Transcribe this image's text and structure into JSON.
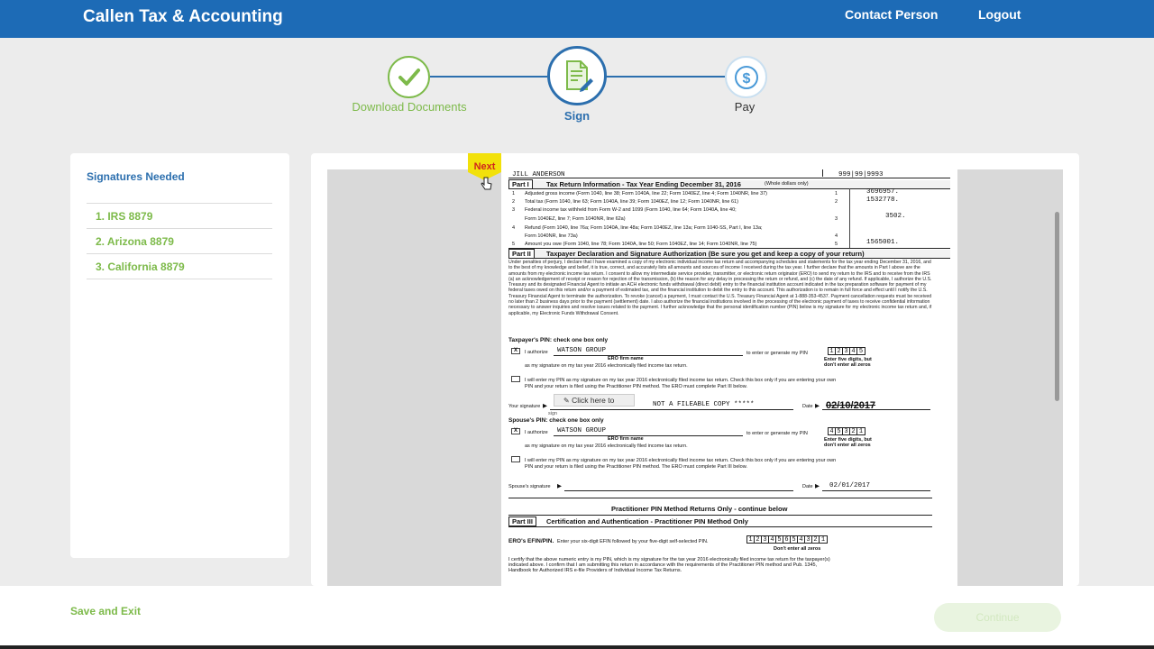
{
  "header": {
    "brand": "Callen Tax & Accounting",
    "contact_label": "Contact Person",
    "logout_label": "Logout"
  },
  "stepper": {
    "steps": [
      {
        "label": "Download Documents",
        "status": "complete",
        "icon": "checkmark-icon"
      },
      {
        "label": "Sign",
        "status": "current",
        "icon": "document-pen-icon"
      },
      {
        "label": "Pay",
        "status": "upcoming",
        "icon": "dollar-icon"
      }
    ]
  },
  "sidebar": {
    "title": "Signatures Needed",
    "items": [
      {
        "label": "1. IRS 8879"
      },
      {
        "label": "2. Arizona 8879"
      },
      {
        "label": "3. California 8879"
      }
    ]
  },
  "next_tag": "Next",
  "document": {
    "taxpayer_name": "JILL  ANDERSON",
    "ssn": "999|99|9993",
    "part1_tag": "Part I",
    "part1_title": "Tax Return Information - Tax Year Ending December 31, 2016",
    "part1_note": "(Whole dollars only)",
    "lines": [
      {
        "num": "1",
        "text": "Adjusted gross income (Form 1040, line 38; Form 1040A, line 22; Form 1040EZ, line 4; Form 1040NR, line 37)",
        "box": "1",
        "amount": "3696957."
      },
      {
        "num": "2",
        "text": "Total tax (Form 1040, line 63; Form 1040A, line 39; Form 1040EZ, line 12; Form 1040NR, line 61)",
        "box": "2",
        "amount": "1532778."
      },
      {
        "num": "3",
        "text": "Federal income tax withheld from Form W-2 and 1099 (Form 1040, line 64; Form 1040A, line 40;",
        "text2": "Form 1040EZ, line 7; Form 1040NR, line 62a)",
        "box": "3",
        "amount": "3502."
      },
      {
        "num": "4",
        "text": "Refund (Form 1040, line 76a; Form 1040A, line 48a; Form 1040EZ, line 13a; Form 1040-SS, Part I, line 13a;",
        "text2": "Form 1040NR, line 73a)",
        "box": "4",
        "amount": ""
      },
      {
        "num": "5",
        "text": "Amount you owe (Form 1040, line 78; Form 1040A, line 50; Form 1040EZ, line 14; Form 1040NR, line 75)",
        "box": "5",
        "amount": "1565001."
      }
    ],
    "part2_tag": "Part II",
    "part2_title": "Taxpayer Declaration and Signature Authorization (Be sure you get and keep a copy of your return)",
    "declaration": "Under penalties of perjury, I declare that I have examined a copy of my electronic individual income tax return and accompanying schedules and statements for the tax year ending December 31, 2016, and to the best of my knowledge and belief, it is true, correct, and accurately lists all amounts and sources of income I received during the tax year. I further declare that the amounts in Part I above are the amounts from my electronic income tax return. I consent to allow my intermediate service provider, transmitter, or electronic return originator (ERO) to send my return to the IRS and to receive from the IRS (a) an acknowledgement of receipt or reason for rejection of the transmission, (b) the reason for any delay in processing the return or refund, and (c) the date of any refund. If applicable, I authorize the U.S. Treasury and its designated Financial Agent to initiate an ACH electronic funds withdrawal (direct debit) entry to the financial institution account indicated in the tax preparation software for payment of my federal taxes owed on this return and/or a payment of estimated tax, and the financial institution to debit the entry to this account. This authorization is to remain in full force and effect until I notify the U.S. Treasury Financial Agent to terminate the authorization. To revoke (cancel) a payment, I must contact the U.S. Treasury Financial Agent at 1-888-353-4537. Payment cancellation requests must be received no later than 2 business days prior to the payment (settlement) date. I also authorize the financial institutions involved in the processing of the electronic payment of taxes to receive confidential information necessary to answer inquiries and resolve issues related to the payment. I further acknowledge that the personal identification number (PIN) below is my signature for my electronic income tax return and, if applicable, my Electronic Funds Withdrawal Consent.",
    "taxpayer_pin_heading": "Taxpayer's PIN: check one box only",
    "i_authorize": "I authorize",
    "firm_name": "WATSON GROUP",
    "ero_firm_label": "ERO firm name",
    "to_enter_pin": "to enter or generate my PIN",
    "taxpayer_pin": [
      "1",
      "2",
      "3",
      "4",
      "5"
    ],
    "pin_note_1": "Enter five digits, but",
    "pin_note_2": "don't enter all zeros",
    "as_signature": "as my signature on my tax year 2016 electronically filed income tax return.",
    "self_enter_1": "I will enter my PIN as my signature on my tax year 2016 electronically filed income tax return. Check this box only if you are entering your own",
    "self_enter_2": "PIN and your return is filed using the Practitioner PIN method. The ERO must complete Part III below.",
    "your_signature_label": "Your signature",
    "not_fileable": "NOT A FILEABLE COPY *****",
    "date_label": "Date",
    "taxpayer_date": "02/10/2017",
    "click_here": "Click here to",
    "sign_word": "sign",
    "spouse_pin_heading": "Spouse's PIN: check one box only",
    "spouse_pin": [
      "4",
      "5",
      "3",
      "2",
      "1"
    ],
    "spouse_signature_label": "Spouse's signature",
    "spouse_date": "02/01/2017",
    "practitioner_heading": "Practitioner PIN Method Returns Only - continue below",
    "part3_tag": "Part III",
    "part3_title": "Certification and Authentication - Practitioner PIN Method Only",
    "efin_label": "ERO's EFIN/PIN.",
    "efin_instructions": "Enter your six-digit EFIN followed by your five-digit self-selected PIN.",
    "efin_pin": [
      "1",
      "2",
      "3",
      "4",
      "5",
      "6",
      "5",
      "4",
      "3",
      "2",
      "1"
    ],
    "efin_note": "Don't enter all zeros",
    "certify_text_1": "I certify that the above numeric entry is my PIN, which is my signature for the tax year 2016 electronically filed income tax return for the taxpayer(s)",
    "certify_text_2": "indicated above. I confirm that I am submitting this return in accordance with the requirements of the Practitioner PIN method and Pub. 1345,",
    "certify_text_3": "Handbook for Authorized IRS e-file Providers of Individual Income Tax Returns."
  },
  "footer": {
    "save_exit": "Save and Exit",
    "continue": "Continue"
  },
  "colors": {
    "header_blue": "#1d6bb6",
    "step_blue": "#2c6fae",
    "green": "#7dba4a",
    "next_yellow": "#f2e10a",
    "next_red": "#d0261c"
  }
}
